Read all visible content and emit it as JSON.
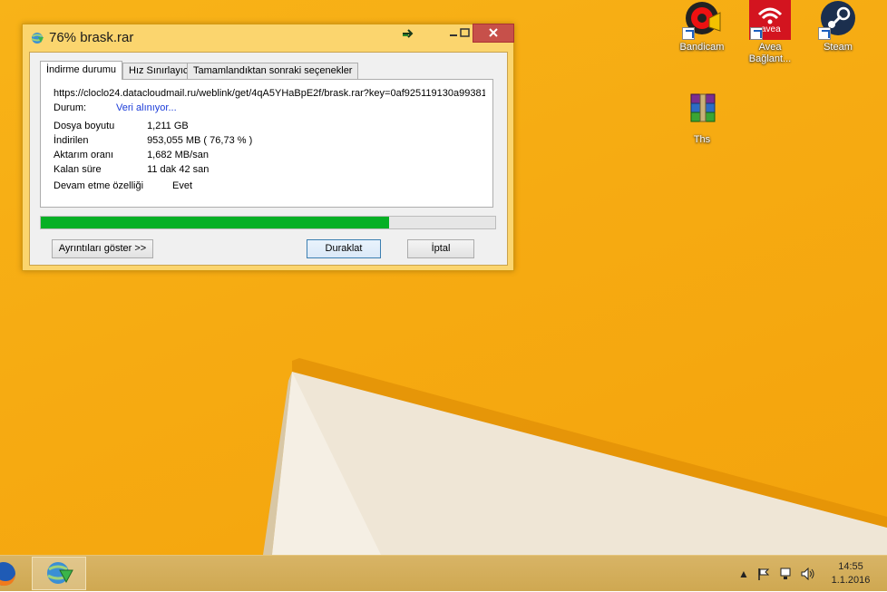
{
  "desktop": {
    "icons": [
      {
        "label": "Bandicam",
        "icon": "bandicam-icon"
      },
      {
        "label": "Avea Bağlant...",
        "icon": "avea-wifi-icon",
        "badge": "avea"
      },
      {
        "label": "Steam",
        "icon": "steam-icon"
      },
      {
        "label": "Ths",
        "icon": "winrar-archive-icon"
      }
    ]
  },
  "window": {
    "title": "76% brask.rar",
    "tabs": [
      {
        "label": "İndirme durumu",
        "active": true
      },
      {
        "label": "Hız Sınırlayıcı",
        "active": false
      },
      {
        "label": "Tamamlandıktan sonraki seçenekler",
        "active": false
      }
    ],
    "url": "https://cloclo24.datacloudmail.ru/weblink/get/4qA5YHaBpE2f/brask.rar?key=0af925119130a99381",
    "status": {
      "label": "Durum:",
      "value": "Veri alınıyor..."
    },
    "fields": [
      {
        "label": "Dosya boyutu",
        "value": "1,211  GB"
      },
      {
        "label": "İndirilen",
        "value": "953,055  MB  ( 76,73 % )"
      },
      {
        "label": "Aktarım oranı",
        "value": "1,682  MB/san"
      },
      {
        "label": "Kalan süre",
        "value": "11 dak 42 san"
      }
    ],
    "resume": {
      "label": "Devam etme özelliği",
      "value": "Evet"
    },
    "progress_fraction": 0.7673,
    "buttons": {
      "details": "Ayrıntıları göster >>",
      "pause": "Duraklat",
      "cancel": "İptal"
    }
  },
  "taskbar": {
    "apps": [
      {
        "name": "firefox-icon"
      },
      {
        "name": "idm-icon",
        "active": true
      }
    ],
    "tray": [
      "show-hidden-icons",
      "flag-icon",
      "network-icon",
      "volume-icon"
    ],
    "time": "14:55",
    "date": "1.1.2016"
  },
  "colors": {
    "wallpaper": "#f6ab12",
    "progress": "#06b025",
    "status_text": "#1a3bd8",
    "close_button": "#c7504a"
  }
}
